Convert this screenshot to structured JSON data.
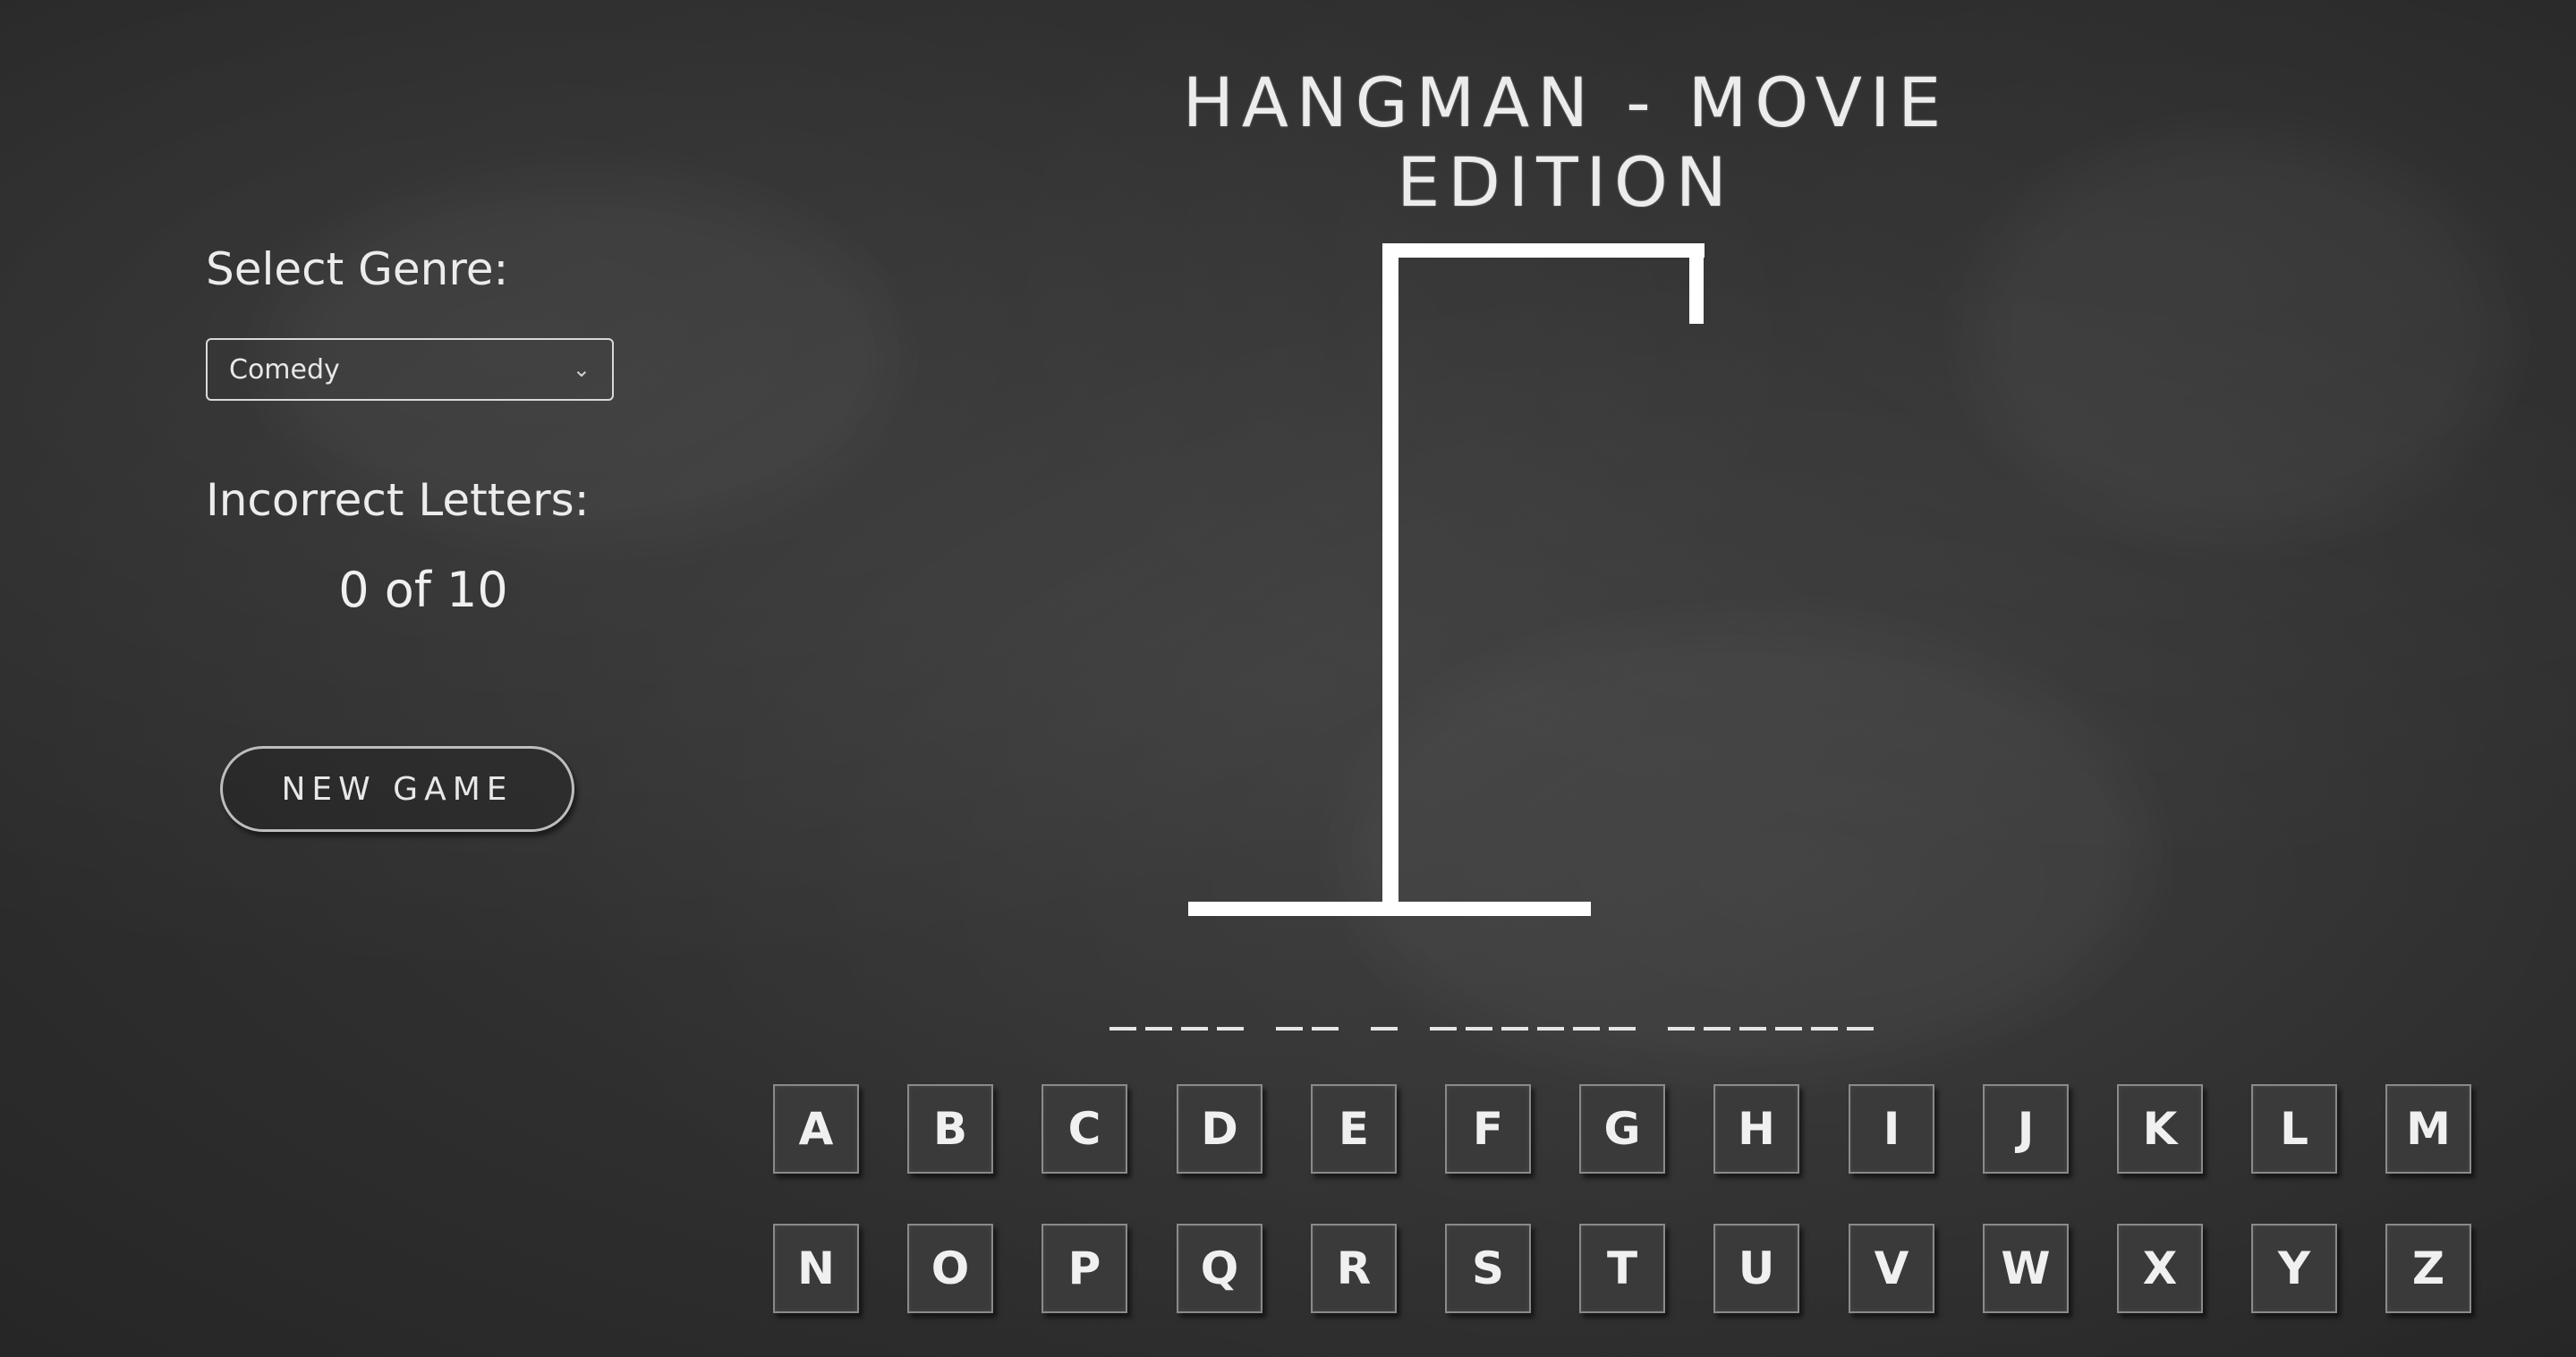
{
  "title": "Hangman - Movie Edition",
  "sidebar": {
    "genre_label": "Select Genre:",
    "genre_selected": "Comedy",
    "incorrect_label": "Incorrect Letters:",
    "incorrect_count": "0 of 10",
    "new_game_label": "New Game"
  },
  "word": {
    "blank_count": 19
  },
  "keyboard": {
    "row1": [
      "A",
      "B",
      "C",
      "D",
      "E",
      "F",
      "G",
      "H",
      "I",
      "J",
      "K",
      "L",
      "M"
    ],
    "row2": [
      "N",
      "O",
      "P",
      "Q",
      "R",
      "S",
      "T",
      "U",
      "V",
      "W",
      "X",
      "Y",
      "Z"
    ]
  },
  "colors": {
    "chalk": "#ffffff",
    "board": "#2f2f2f"
  },
  "icons": {
    "select_chevron": "chevron-down-icon"
  }
}
